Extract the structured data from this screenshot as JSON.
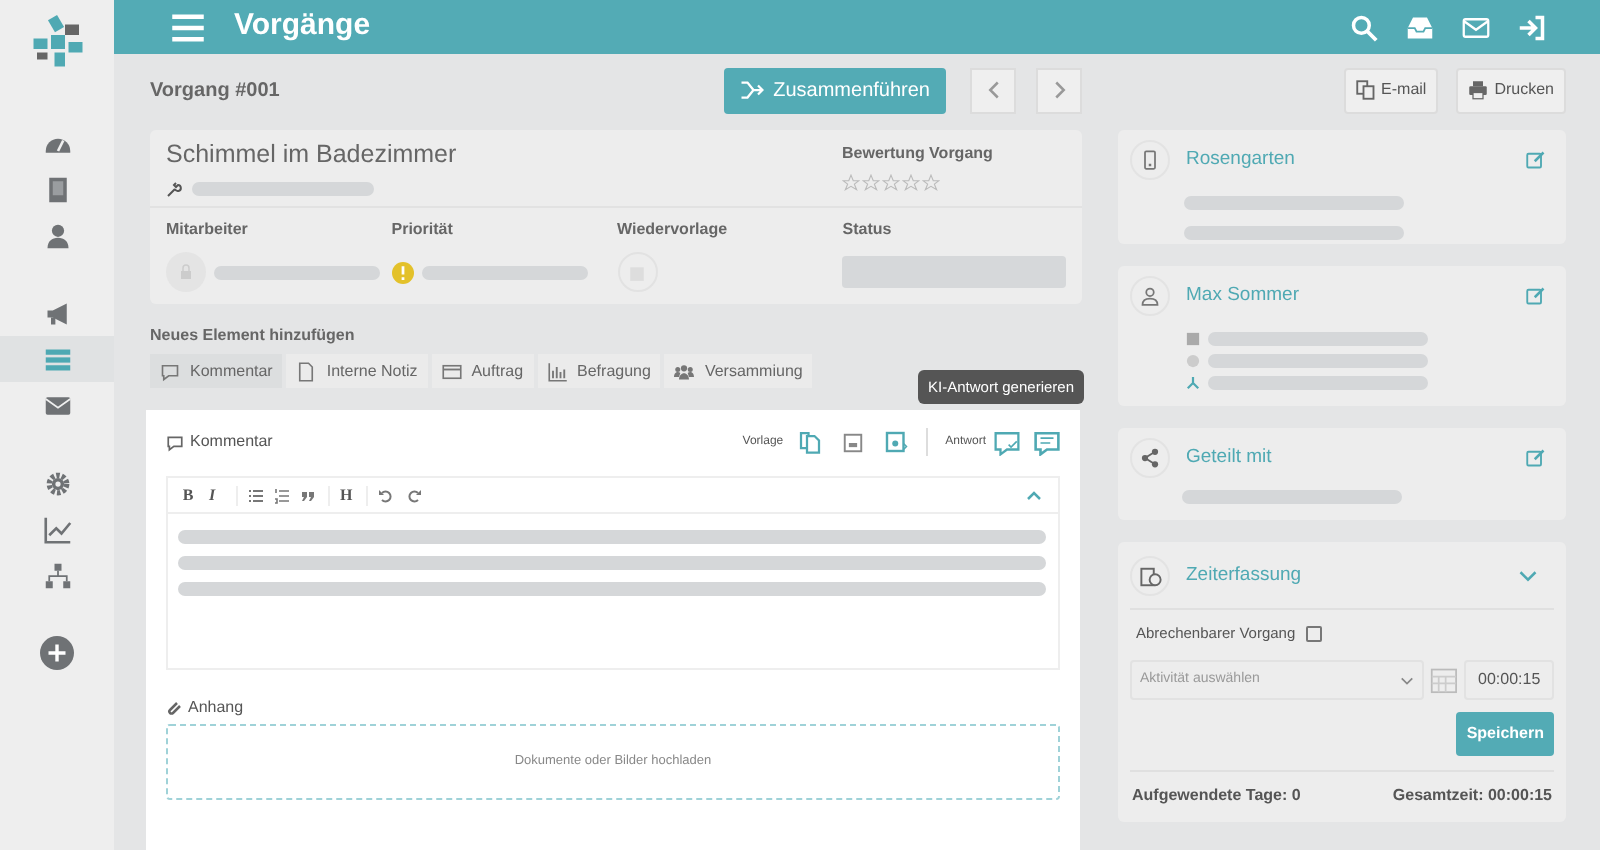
{
  "sidebar": {
    "groups": [
      {
        "items": [
          {
            "kind": "dashboard",
            "selected": false
          },
          {
            "kind": "building",
            "selected": false
          },
          {
            "kind": "user",
            "selected": false
          }
        ]
      },
      {
        "items": [
          {
            "kind": "megaphone",
            "selected": false
          },
          {
            "kind": "list",
            "selected": true
          },
          {
            "kind": "mail",
            "selected": false
          }
        ]
      },
      {
        "items": [
          {
            "kind": "gear",
            "selected": false
          },
          {
            "kind": "chart",
            "selected": false
          },
          {
            "kind": "sitemap",
            "selected": false
          }
        ]
      },
      {
        "items": [
          {
            "kind": "add",
            "selected": false
          }
        ]
      }
    ]
  },
  "header": {
    "title": "Vorgänge"
  },
  "toolbar": {
    "case_number": "Vorgang #001",
    "merge_button": "Zusammenführen",
    "email_button": "E-mail",
    "print_button": "Drucken"
  },
  "case_card": {
    "title": "Schimmel im Badezimmer",
    "rating_label": "Bewertung Vorgang",
    "stars": 0,
    "fields": [
      {
        "label": "Mitarbeiter",
        "kind": "avatar"
      },
      {
        "label": "Priorität",
        "kind": "priority"
      },
      {
        "label": "Wiedervorlage",
        "kind": "date"
      },
      {
        "label": "Status",
        "kind": "status"
      }
    ]
  },
  "new_element": {
    "heading": "Neues Element hinzufügen",
    "tabs": [
      {
        "label": "Kommentar",
        "kind": "comment",
        "selected": true
      },
      {
        "label": "Interne Notiz",
        "kind": "note",
        "selected": false
      },
      {
        "label": "Auftrag",
        "kind": "order",
        "selected": false
      },
      {
        "label": "Befragung",
        "kind": "survey",
        "selected": false
      },
      {
        "label": "Versammiung",
        "kind": "meeting",
        "selected": false
      }
    ]
  },
  "editor": {
    "title": "Kommentar",
    "template_label": "Vorlage",
    "reply_label": "Antwort",
    "tooltip": "KI-Antwort generieren",
    "format_buttons": [
      {
        "kind": "bold",
        "label": "B"
      },
      {
        "kind": "italic",
        "label": "I"
      },
      {
        "kind": "bullets"
      },
      {
        "kind": "numbers"
      },
      {
        "kind": "quote"
      },
      {
        "kind": "heading",
        "label": "H"
      },
      {
        "kind": "undo"
      },
      {
        "kind": "redo"
      }
    ]
  },
  "attachment": {
    "label": "Anhang",
    "dropzone": "Dokumente oder Bilder hochladen"
  },
  "side_cards": [
    {
      "title": "Rosengarten",
      "kind": "property"
    },
    {
      "title": "Max Sommer",
      "kind": "person"
    },
    {
      "title": "Geteilt mit",
      "kind": "shared"
    }
  ],
  "time_tracking": {
    "title": "Zeiterfassung",
    "expanded": true,
    "billable_label": "Abrechenbarer Vorgang",
    "billable": false,
    "activity_placeholder": "Aktivität auswählen",
    "time": "00:00:15",
    "save_button": "Speichern",
    "days_spent": "Aufgewendete Tage: 0",
    "total_time": "Gesamtzeit: 00:00:15"
  }
}
